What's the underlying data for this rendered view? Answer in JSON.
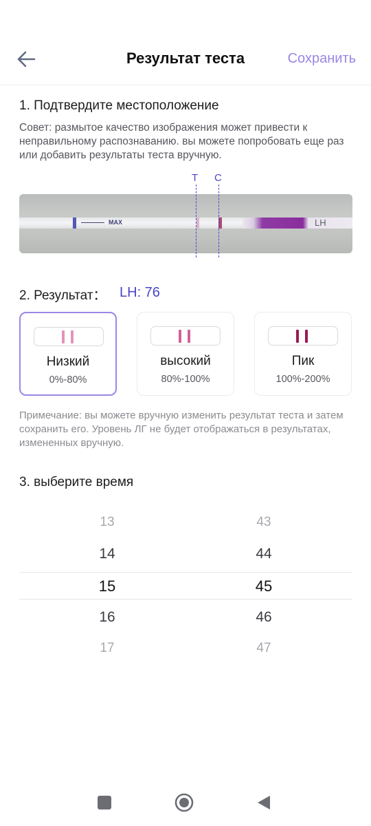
{
  "header": {
    "title": "Результат теста",
    "save_label": "Сохранить",
    "back_icon": "arrow-left-icon"
  },
  "section1": {
    "title": "1. Подтвердите местоположение",
    "hint": "Совет: размытое качество изображения может привести к неправильному распознаванию. вы можете попробовать еще раз или добавить результаты теста вручную.",
    "marker_t": "T",
    "marker_c": "C",
    "strip": {
      "max_text": "MAX",
      "lh_text": "LH"
    }
  },
  "section2": {
    "title": "2. Результат：",
    "lh_value": "LH: 76",
    "cards": [
      {
        "label": "Низкий",
        "range": "0%-80%",
        "selected": true,
        "line_color": "#e493b9"
      },
      {
        "label": "высокий",
        "range": "80%-100%",
        "selected": false,
        "line_color": "#d2619a"
      },
      {
        "label": "Пик",
        "range": "100%-200%",
        "selected": false,
        "line_color": "#9a1b52"
      }
    ],
    "note": "Примечание: вы можете вручную изменить результат теста и затем сохранить его. Уровень ЛГ не будет отображаться в результатах, измененных вручную."
  },
  "section3": {
    "title": "3. выберите время",
    "hours": [
      "13",
      "14",
      "15",
      "16",
      "17"
    ],
    "minutes": [
      "43",
      "44",
      "45",
      "46",
      "47"
    ],
    "selected_hour": "15",
    "selected_minute": "45"
  },
  "colors": {
    "accent": "#9b86e6",
    "marker": "#4a45c8"
  },
  "navbar": {
    "icons": [
      "recent-apps-icon",
      "home-icon",
      "back-triangle-icon"
    ]
  }
}
